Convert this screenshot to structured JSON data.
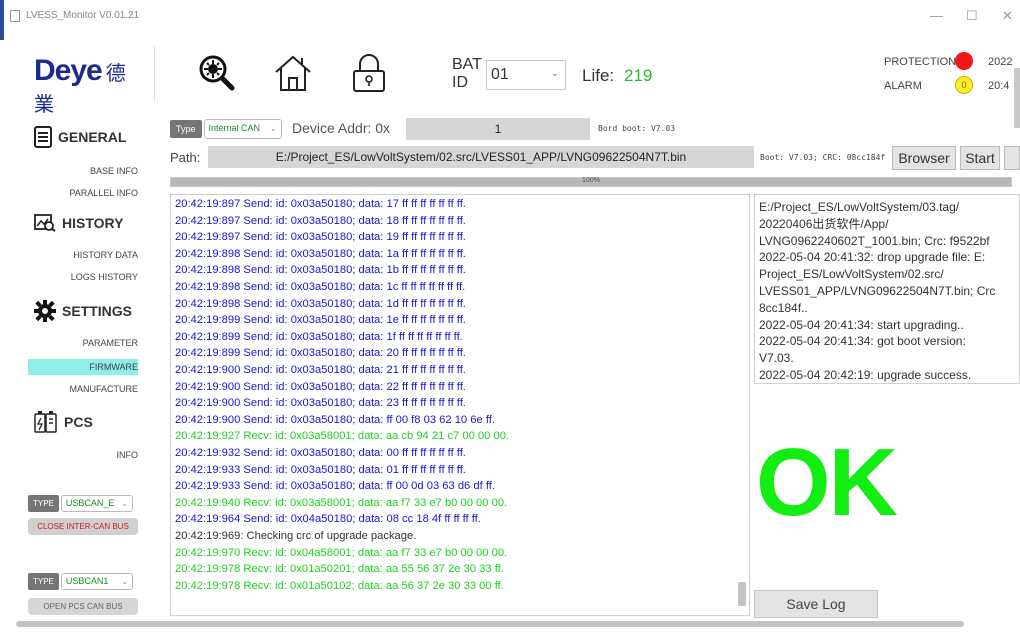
{
  "window": {
    "title": "LVESS_Monitor V0.01.21",
    "controls": [
      "—",
      "☐",
      "✕"
    ]
  },
  "header": {
    "logo_text": "Deye",
    "logo_cn": "德業",
    "icons": [
      "virus-scan-icon",
      "home-icon",
      "lock-icon"
    ],
    "bat_id_label_1": "BAT",
    "bat_id_label_2": "ID",
    "bat_id_value": "01",
    "life_label": "Life:",
    "life_value": "219",
    "protection_label": "PROTECTION",
    "alarm_label": "ALARM",
    "alarm_count": "0",
    "clock_line1": "2022",
    "clock_line2": "20:4",
    "colors": {
      "protection": "#f01818",
      "alarm": "#ffee22"
    }
  },
  "sidebar": {
    "general": {
      "label": "GENERAL",
      "items": [
        "BASE INFO",
        "PARALLEL INFO"
      ]
    },
    "history": {
      "label": "HISTORY",
      "items": [
        "HISTORY DATA",
        "LOGS HISTORY"
      ]
    },
    "settings": {
      "label": "SETTINGS",
      "items": [
        "PARAMETER",
        "FIRMWARE",
        "MANUFACTURE"
      ],
      "active": "FIRMWARE"
    },
    "pcs": {
      "label": "PCS",
      "items": [
        "INFO"
      ]
    },
    "can1": {
      "type_label": "TYPE",
      "type_value": "USBCAN_E",
      "button": "CLOSE INTER-CAN BUS"
    },
    "can2": {
      "type_label": "TYPE",
      "type_value": "USBCAN1",
      "button": "OPEN PCS CAN BUS"
    }
  },
  "main": {
    "type_label": "Type",
    "type_value": "Internal CAN",
    "device_addr_label": "Device Addr: 0x",
    "device_addr_value": "1",
    "bord_boot": "Bord boot: V7.03",
    "path_label": "Path:",
    "path_value": "E:/Project_ES/LowVoltSystem/02.src/LVESS01_APP/LVNG09622504N7T.bin",
    "boot_crc": "Boot: V7.03; CRC: 08cc184f",
    "browser_button": "Browser",
    "start_button": "Start",
    "progress": {
      "value": 1.0,
      "label": "100%"
    }
  },
  "log": [
    {
      "type": "send",
      "text": "20:42:19:897 Send: id: 0x03a50180; data: 17 ff ff ff ff ff ff ff."
    },
    {
      "type": "send",
      "text": "20:42:19:897 Send: id: 0x03a50180; data: 18 ff ff ff ff ff ff ff."
    },
    {
      "type": "send",
      "text": "20:42:19:897 Send: id: 0x03a50180; data: 19 ff ff ff ff ff ff ff."
    },
    {
      "type": "send",
      "text": "20:42:19:898 Send: id: 0x03a50180; data: 1a ff ff ff ff ff ff ff."
    },
    {
      "type": "send",
      "text": "20:42:19:898 Send: id: 0x03a50180; data: 1b ff ff ff ff ff ff ff."
    },
    {
      "type": "send",
      "text": "20:42:19:898 Send: id: 0x03a50180; data: 1c ff ff ff ff ff ff ff."
    },
    {
      "type": "send",
      "text": "20:42:19:898 Send: id: 0x03a50180; data: 1d ff ff ff ff ff ff ff."
    },
    {
      "type": "send",
      "text": "20:42:19:899 Send: id: 0x03a50180; data: 1e ff ff ff ff ff ff ff."
    },
    {
      "type": "send",
      "text": "20:42:19:899 Send: id: 0x03a50180; data: 1f ff ff ff ff ff ff ff."
    },
    {
      "type": "send",
      "text": "20:42:19:899 Send: id: 0x03a50180; data: 20 ff ff ff ff ff ff ff."
    },
    {
      "type": "send",
      "text": "20:42:19:900 Send: id: 0x03a50180; data: 21 ff ff ff ff ff ff ff."
    },
    {
      "type": "send",
      "text": "20:42:19:900 Send: id: 0x03a50180; data: 22 ff ff ff ff ff ff ff."
    },
    {
      "type": "send",
      "text": "20:42:19:900 Send: id: 0x03a50180; data: 23 ff ff ff ff ff ff ff."
    },
    {
      "type": "send",
      "text": "20:42:19:900 Send: id: 0x03a50180; data: ff 00 f8 03 62 10 6e ff."
    },
    {
      "type": "recv",
      "text": "20:42:19:927 Recv: id: 0x03a58001; data: aa cb 94 21 c7 00 00 00."
    },
    {
      "type": "send",
      "text": "20:42:19:932 Send: id: 0x03a50180; data: 00 ff ff ff ff ff ff ff."
    },
    {
      "type": "send",
      "text": "20:42:19:933 Send: id: 0x03a50180; data: 01 ff ff ff ff ff ff ff."
    },
    {
      "type": "send",
      "text": "20:42:19:933 Send: id: 0x03a50180; data: ff 00 0d 03 63 d6 df ff."
    },
    {
      "type": "recv",
      "text": "20:42:19:940 Recv: id: 0x03a58001; data: aa f7 33 e7 b0 00 00 00."
    },
    {
      "type": "send",
      "text": "20:42:19:964 Send: id: 0x04a50180; data: 08 cc 18 4f ff ff ff ff."
    },
    {
      "type": "info",
      "text": "20:42:19:969: Checking crc of upgrade package."
    },
    {
      "type": "recv",
      "text": "20:42:19:970 Recv: id: 0x04a58001; data: aa f7 33 e7 b0 00 00 00."
    },
    {
      "type": "recv",
      "text": "20:42:19:978 Recv: id: 0x01a50201; data: aa 55 56 37 2e 30 33 ff."
    },
    {
      "type": "recv",
      "text": "20:42:19:978 Recv: id: 0x01a50102; data: aa 56 37 2e 30 33 00 ff."
    }
  ],
  "info_panel": [
    "E:/Project_ES/LowVoltSystem/03.tag/",
    "20220406出货软件/App/",
    "LVNG0962240602T_1001.bin; Crc: f9522bf",
    "2022-05-04 20:41:32: drop upgrade file: E:",
    "Project_ES/LowVoltSystem/02.src/",
    "LVESS01_APP/LVNG09622504N7T.bin; Crc",
    "8cc184f..",
    "2022-05-04 20:41:34: start upgrading..",
    "2022-05-04 20:41:34: got boot version:",
    "V7.03.",
    "2022-05-04 20:42:19: upgrade success."
  ],
  "status": {
    "result": "OK",
    "color": "#12ee12"
  },
  "save_log_button": "Save Log"
}
